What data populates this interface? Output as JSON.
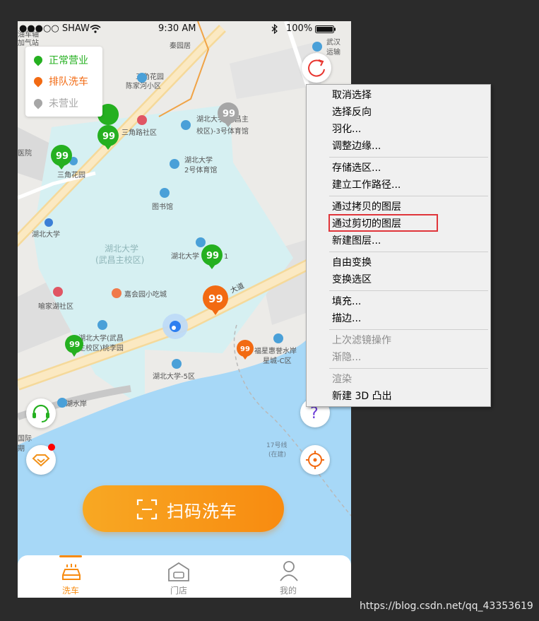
{
  "status_bar": {
    "carrier": "●●●○○ SHAW",
    "time": "9:30 AM",
    "battery": "100%"
  },
  "legend": [
    {
      "label": "正常营业",
      "color": "#25b020"
    },
    {
      "label": "排队洗车",
      "color": "#f26a12"
    },
    {
      "label": "未营业",
      "color": "#a6a6a6"
    }
  ],
  "map_labels": {
    "top_left_1": "油车轴",
    "top_left_2": "加气站",
    "qinyuanju": "秦园居",
    "wuhan_transport_1": "武汉",
    "wuhan_transport_2": "运输",
    "sanjiaohuayuan_chenjiahe_1": "三角花园",
    "sanjiaohuayuan_chenjiahe_2": "陈家河小区",
    "sanjiaolu": "三角路社区",
    "hubei_gym3_1": "湖北大学(武昌主",
    "hubei_gym3_2": "校区)-3号体育馆",
    "hospital": "医院",
    "sanjiaohuayuan": "三角花园",
    "hubei_gym2_1": "湖北大学",
    "hubei_gym2_2": "2号体育馆",
    "library": "图书馆",
    "hubei_univ_subway": "湖北大学",
    "hubei_univ_campus_1": "湖北大学",
    "hubei_univ_campus_2": "(武昌主校区)",
    "hubei_univ_short": "湖北大学",
    "short_1": "1",
    "yujiahu": "喻家湖社区",
    "jiahuiyuan": "嘉会园小吃城",
    "avenue": "大道",
    "taoliyuan_1": "湖北大学(武昌",
    "taoliyuan_2": "主校区)桃李园",
    "fuxing_1": "福星惠誉水岸",
    "fuxing_2": "星城-C区",
    "hubei_5": "湖北大学-5区",
    "menghu": "梦湖水岸",
    "intl_1": "国际",
    "intl_2": "期",
    "line17_1": "17号线",
    "line17_2": "(在建)"
  },
  "scan_button": {
    "label": "扫码洗车"
  },
  "tabs": [
    {
      "label": "洗车",
      "active": true
    },
    {
      "label": "门店",
      "active": false
    },
    {
      "label": "我的",
      "active": false
    }
  ],
  "context_menu": {
    "groups": [
      [
        {
          "label": "取消选择"
        },
        {
          "label": "选择反向"
        },
        {
          "label": "羽化..."
        },
        {
          "label": "调整边缘..."
        }
      ],
      [
        {
          "label": "存储选区..."
        },
        {
          "label": "建立工作路径..."
        }
      ],
      [
        {
          "label": "通过拷贝的图层"
        },
        {
          "label": "通过剪切的图层",
          "highlighted": true
        },
        {
          "label": "新建图层..."
        }
      ],
      [
        {
          "label": "自由变换"
        },
        {
          "label": "变换选区"
        }
      ],
      [
        {
          "label": "填充..."
        },
        {
          "label": "描边..."
        }
      ],
      [
        {
          "label": "上次滤镜操作",
          "disabled": true
        },
        {
          "label": "渐隐...",
          "disabled": true
        }
      ],
      [
        {
          "label": "渲染",
          "disabled": true
        },
        {
          "label": "新建 3D 凸出"
        }
      ]
    ]
  },
  "watermark": "https://blog.csdn.net/qq_43353619",
  "colors": {
    "accent_orange": "#f88b10",
    "open_green": "#25b020",
    "queue_orange": "#f26a12",
    "closed_gray": "#a6a6a6",
    "campus_cyan": "#d6f0f2",
    "water_blue": "#a7d8f7",
    "highlight_red": "#e0353a"
  },
  "icons": [
    "wifi-icon",
    "bluetooth-icon",
    "battery-icon",
    "refresh-icon",
    "headset-icon",
    "vip-icon",
    "help-icon",
    "locate-icon",
    "scan-icon",
    "car-wash-icon",
    "store-icon",
    "user-icon"
  ]
}
